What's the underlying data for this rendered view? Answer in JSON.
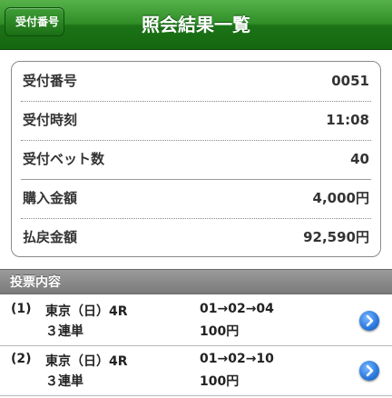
{
  "header": {
    "back_label": "受付番号",
    "title": "照会結果一覧"
  },
  "summary": {
    "rows": [
      {
        "label": "受付番号",
        "value": "0051"
      },
      {
        "label": "受付時刻",
        "value": "11:08"
      },
      {
        "label": "受付ベット数",
        "value": "40"
      },
      {
        "label": "購入金額",
        "value": "4,000円"
      },
      {
        "label": "払戻金額",
        "value": "92,590円"
      }
    ]
  },
  "bets_section": {
    "title": "投票内容",
    "items": [
      {
        "number": "(1)",
        "race": "東京（日）4R",
        "type": "３連単",
        "combination": "01→02→04",
        "amount": "100円"
      },
      {
        "number": "(2)",
        "race": "東京（日）4R",
        "type": "３連単",
        "combination": "01→02→10",
        "amount": "100円"
      }
    ]
  },
  "colors": {
    "header_green": "#2f8e27",
    "section_gray": "#8a8a8a",
    "detail_button_blue": "#2e7ce0"
  }
}
